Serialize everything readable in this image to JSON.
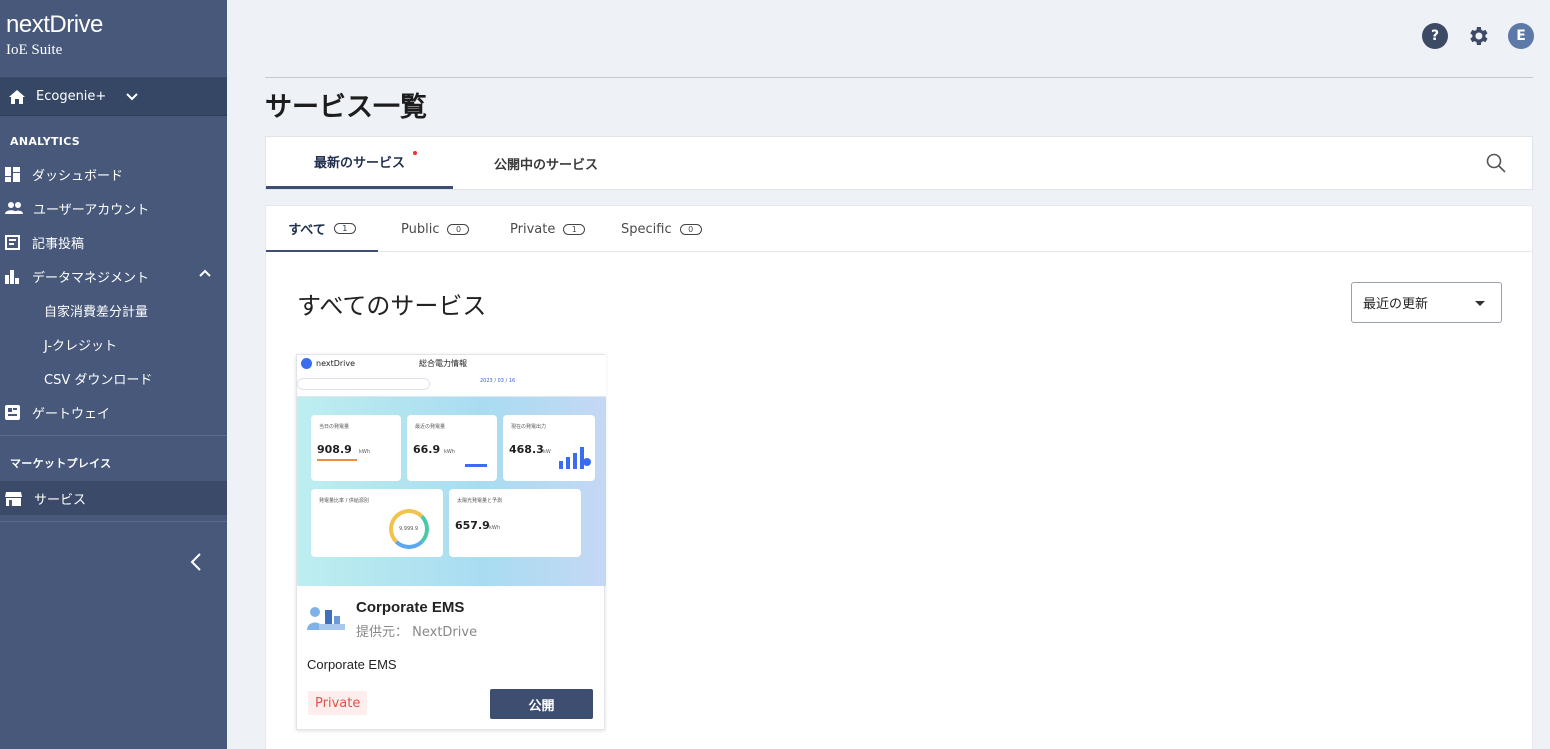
{
  "brand": {
    "name": "nextDrive",
    "suite": "IoE Suite"
  },
  "org_selector": {
    "label": "Ecogenie+"
  },
  "sidebar": {
    "analytics_title": "ANALYTICS",
    "items": [
      {
        "label": "ダッシュボード",
        "icon": "dashboard-icon"
      },
      {
        "label": "ユーザーアカウント",
        "icon": "users-icon"
      },
      {
        "label": "記事投稿",
        "icon": "article-icon"
      },
      {
        "label": "データマネジメント",
        "icon": "bar-chart-icon"
      }
    ],
    "sub_items": [
      {
        "label": "自家消費差分計量"
      },
      {
        "label": "J-クレジット"
      },
      {
        "label": "CSV ダウンロード"
      }
    ],
    "gateway": {
      "label": "ゲートウェイ",
      "icon": "gateway-icon"
    },
    "marketplace_title": "マーケットプレイス",
    "service": {
      "label": "サービス",
      "icon": "store-icon"
    }
  },
  "topbar": {
    "help_glyph": "?",
    "avatar_initial": "E"
  },
  "page": {
    "title": "サービス一覧"
  },
  "tabs": [
    {
      "label": "最新のサービス"
    },
    {
      "label": "公開中のサービス"
    }
  ],
  "subtabs": [
    {
      "label": "すべて",
      "count": "1"
    },
    {
      "label": "Public",
      "count": "0"
    },
    {
      "label": "Private",
      "count": "1"
    },
    {
      "label": "Specific",
      "count": "0"
    }
  ],
  "section": {
    "title": "すべてのサービス"
  },
  "sort": {
    "value": "最近の更新"
  },
  "card": {
    "name": "Corporate EMS",
    "provider": "提供元： NextDrive",
    "description": "Corporate EMS",
    "badge": "Private",
    "button": "公開",
    "thumb": {
      "logo": "nextDrive",
      "title": "総合電力情報",
      "date": "2023 / 03 / 16",
      "num1": "908.9",
      "unit1": "kWh",
      "num2": "66.9",
      "unit2": "kWh",
      "num3": "468.3",
      "unit3": "kW",
      "num4": "657.9",
      "unit4": "kWh",
      "ring_value": "9,999.9",
      "card1_title": "当日の発電量",
      "card2_title": "最近の発電量",
      "card3_title": "現在の発電出力",
      "card4_title": "発電量比率 / 供給源別",
      "card5_title": "太陽光発電量と予測"
    }
  },
  "colors": {
    "sidebar": "#47587a",
    "accent": "#3e4e70",
    "badge_text": "#e1524a"
  }
}
